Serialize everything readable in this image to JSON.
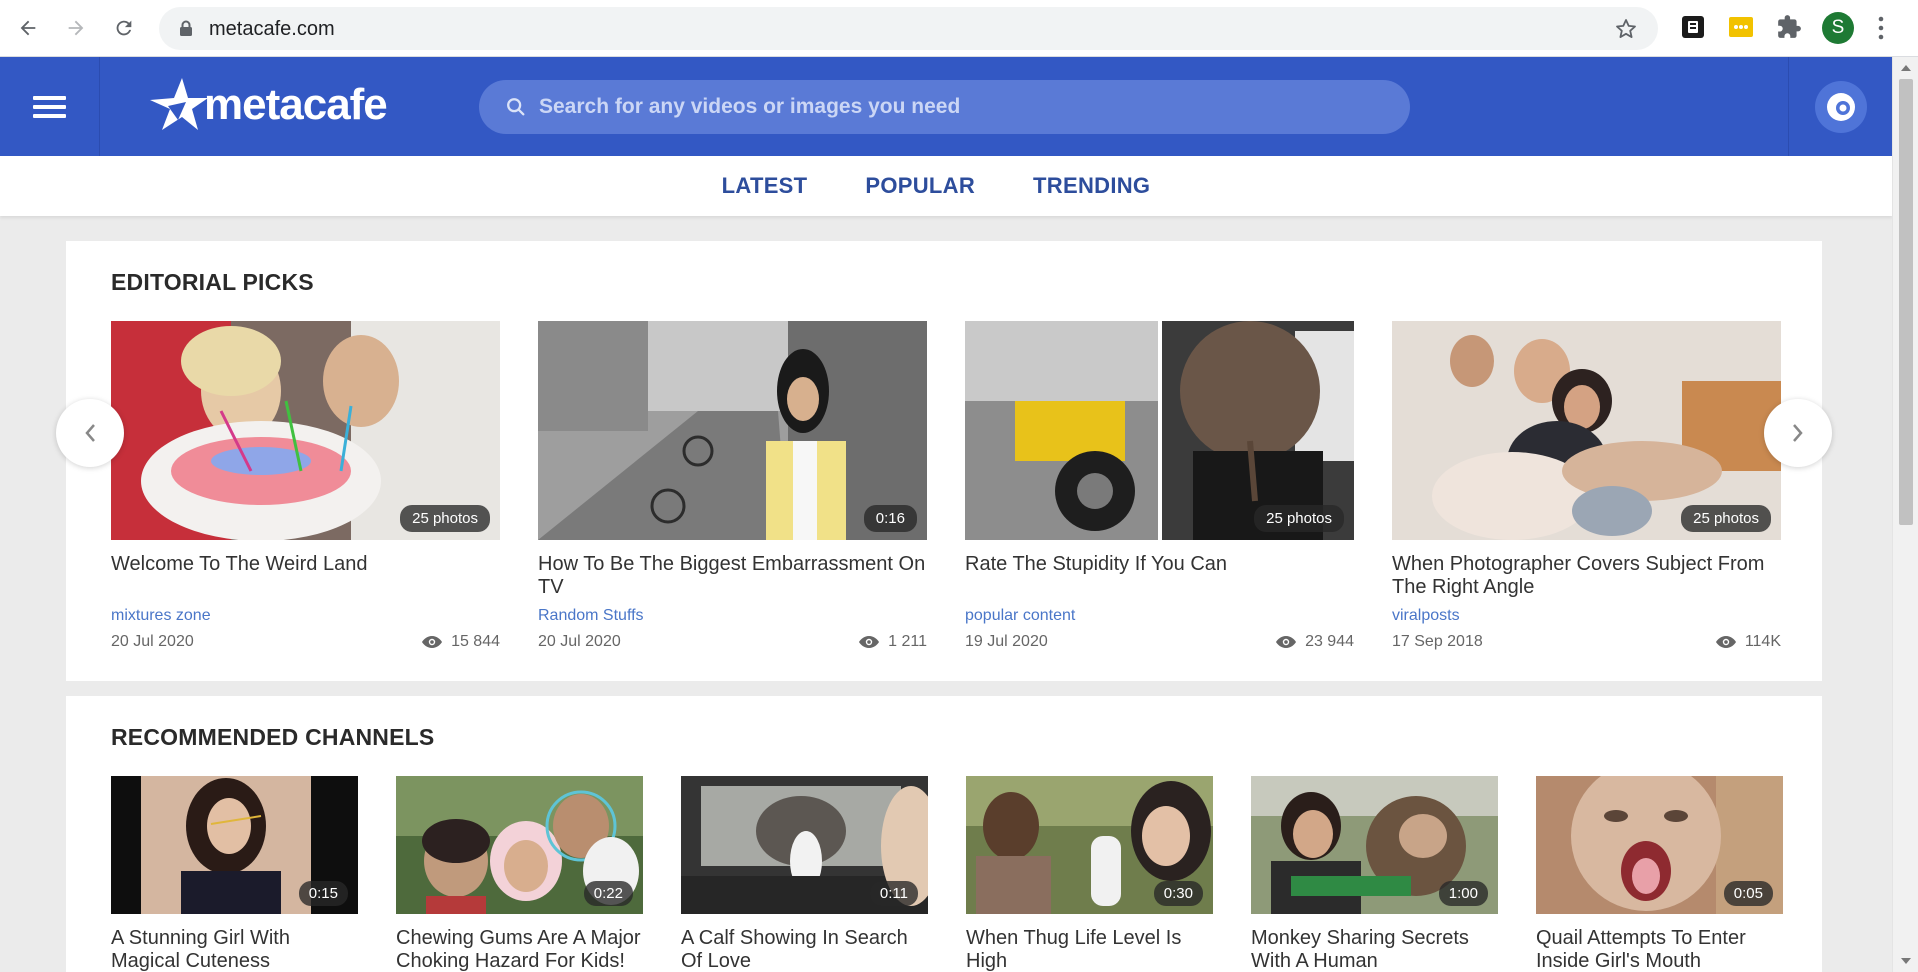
{
  "browser": {
    "url": "metacafe.com",
    "profile_initial": "S",
    "icons": [
      "back-icon",
      "forward-icon",
      "reload-icon",
      "lock-icon",
      "star-icon",
      "extension-icon",
      "puzzle-icon",
      "menu-dots-icon"
    ]
  },
  "header": {
    "logo_text": "metacafe",
    "search_placeholder": "Search for any videos or images you need",
    "brand_color": "#3358c4"
  },
  "tabs": [
    {
      "label": "LATEST"
    },
    {
      "label": "POPULAR"
    },
    {
      "label": "TRENDING"
    }
  ],
  "editorial": {
    "title": "EDITORIAL PICKS",
    "items": [
      {
        "title": "Welcome To The Weird Land",
        "badge": "25 photos",
        "channel": "mixtures zone",
        "date": "20 Jul 2020",
        "views": "15 844"
      },
      {
        "title": "How To Be The Biggest Embarrassment On TV",
        "badge": "0:16",
        "channel": "Random Stuffs",
        "date": "20 Jul 2020",
        "views": "1 211"
      },
      {
        "title": "Rate The Stupidity If You Can",
        "badge": "25 photos",
        "channel": "popular content",
        "date": "19 Jul 2020",
        "views": "23 944"
      },
      {
        "title": "When Photographer Covers Subject From The Right Angle",
        "badge": "25 photos",
        "channel": "viralposts",
        "date": "17 Sep 2018",
        "views": "114K"
      }
    ]
  },
  "channels": {
    "title": "RECOMMENDED CHANNELS",
    "items": [
      {
        "title": "A Stunning Girl With Magical Cuteness",
        "badge": "0:15"
      },
      {
        "title": "Chewing Gums Are A Major Choking Hazard For Kids!",
        "badge": "0:22"
      },
      {
        "title": "A Calf Showing In Search Of Love",
        "badge": "0:11"
      },
      {
        "title": "When Thug Life Level Is High",
        "badge": "0:30"
      },
      {
        "title": "Monkey Sharing Secrets With A Human",
        "badge": "1:00"
      },
      {
        "title": "Quail Attempts To Enter Inside Girl's Mouth",
        "badge": "0:05"
      }
    ]
  }
}
